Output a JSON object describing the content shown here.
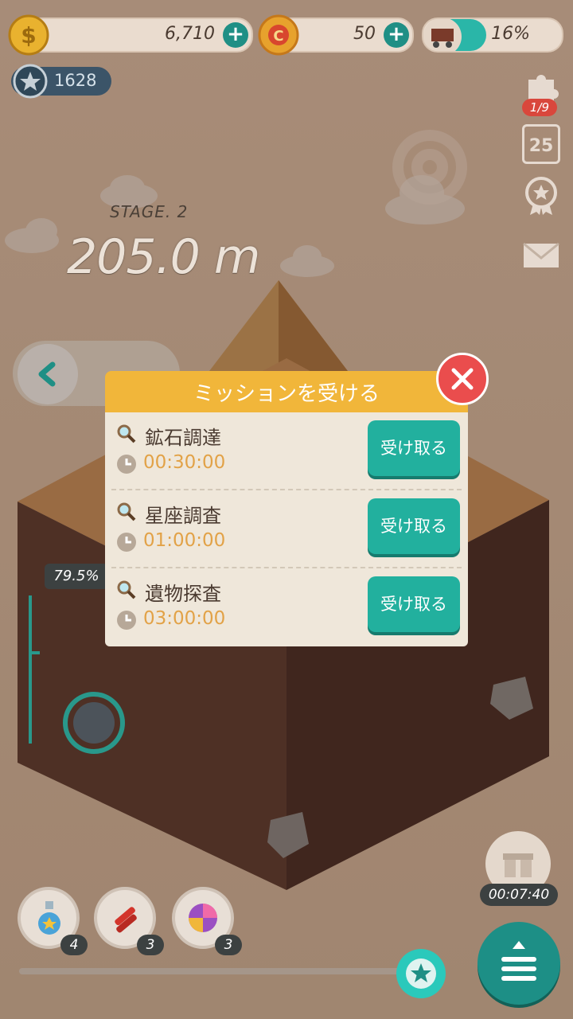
{
  "hud": {
    "gold": "6,710",
    "gems": "50",
    "cart_progress": "16%",
    "cart_progress_value": 0.16,
    "badge_points": "1628",
    "puzzle_count": "1/9",
    "calendar_day": "25"
  },
  "stage": {
    "label": "STAGE. 2",
    "distance": "205.0 m",
    "depth_percent": "79.5%"
  },
  "modal": {
    "title": "ミッションを受ける",
    "missions": [
      {
        "name": "鉱石調達",
        "time": "00:30:00",
        "button": "受け取る"
      },
      {
        "name": "星座調査",
        "time": "01:00:00",
        "button": "受け取る"
      },
      {
        "name": "遺物探査",
        "time": "03:00:00",
        "button": "受け取る"
      }
    ]
  },
  "items": [
    {
      "icon": "potion-icon",
      "count": "4"
    },
    {
      "icon": "dynamite-icon",
      "count": "3"
    },
    {
      "icon": "candy-icon",
      "count": "3"
    }
  ],
  "gift_timer": "00:07:40",
  "colors": {
    "teal": "#1f8f85",
    "modal_header": "#f1b63a",
    "close": "#ea4d4d",
    "time_text": "#e2a247"
  }
}
